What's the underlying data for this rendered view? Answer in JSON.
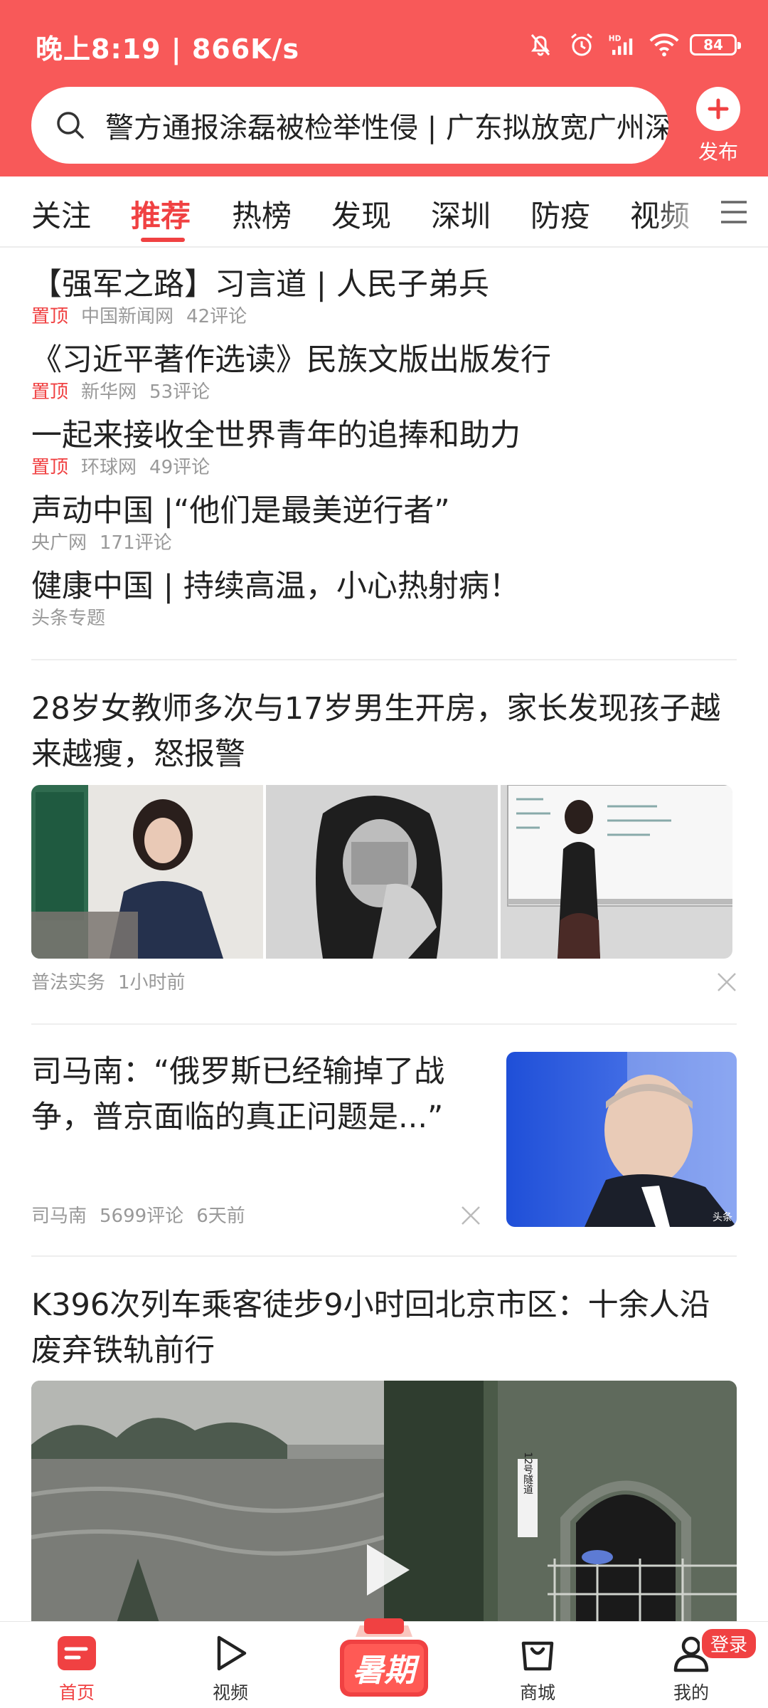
{
  "status_bar": {
    "time": "晚上8:19 | 866K/s",
    "battery": "84",
    "icons": [
      "bell-off-icon",
      "alarm-icon",
      "hd-signal-icon",
      "wifi-icon",
      "battery-icon"
    ]
  },
  "search": {
    "placeholder": "警方通报涂磊被检举性侵 | 广东拟放宽广州深圳落户"
  },
  "publish": {
    "label": "发布"
  },
  "tabs": [
    {
      "label": "关注"
    },
    {
      "label": "推荐",
      "active": true
    },
    {
      "label": "热榜"
    },
    {
      "label": "发现"
    },
    {
      "label": "深圳"
    },
    {
      "label": "防疫"
    },
    {
      "label": "视频"
    }
  ],
  "pinned": [
    {
      "title": "【强军之路】习言道 | 人民子弟兵",
      "pin": "置顶",
      "source": "中国新闻网",
      "comments": "42评论"
    },
    {
      "title": "《习近平著作选读》民族文版出版发行",
      "pin": "置顶",
      "source": "新华网",
      "comments": "53评论"
    },
    {
      "title": "一起来接收全世界青年的追捧和助力",
      "pin": "置顶",
      "source": "环球网",
      "comments": "49评论"
    },
    {
      "title": "声动中国 |“他们是最美逆行者”",
      "pin": "",
      "source": "央广网",
      "comments": "171评论"
    },
    {
      "title": "健康中国 | 持续高温，小心热射病！",
      "pin": "",
      "source": "头条专题",
      "comments": ""
    }
  ],
  "articles": [
    {
      "title_line1": "28岁女教师多次与17岁男生开房，家长发现孩子越",
      "title_line2": "来越瘦，怒报警",
      "source": "普法实务",
      "time": "1小时前"
    },
    {
      "title_line1": "司马南：“俄罗斯已经输掉了战",
      "title_line2": "争，普京面临的真正问题是...”",
      "source": "司马南",
      "comments": "5699评论",
      "time": "6天前",
      "thumb_caption": "头条"
    },
    {
      "title_line1": "K396次列车乘客徒步9小时回北京市区：十余人沿",
      "title_line2": "废弃铁轨前行",
      "tunnel_sign": "12号隧道"
    }
  ],
  "bottom_nav": [
    {
      "label": "首页",
      "icon": "home-icon",
      "active": true
    },
    {
      "label": "视频",
      "icon": "play-icon"
    },
    {
      "label": "暑期",
      "icon": "summer-icon"
    },
    {
      "label": "商城",
      "icon": "shopping-bag-icon"
    },
    {
      "label": "我的",
      "icon": "person-icon"
    }
  ],
  "login_badge": "登录",
  "colors": {
    "brand_red": "#f85959",
    "accent_red": "#f04142"
  }
}
